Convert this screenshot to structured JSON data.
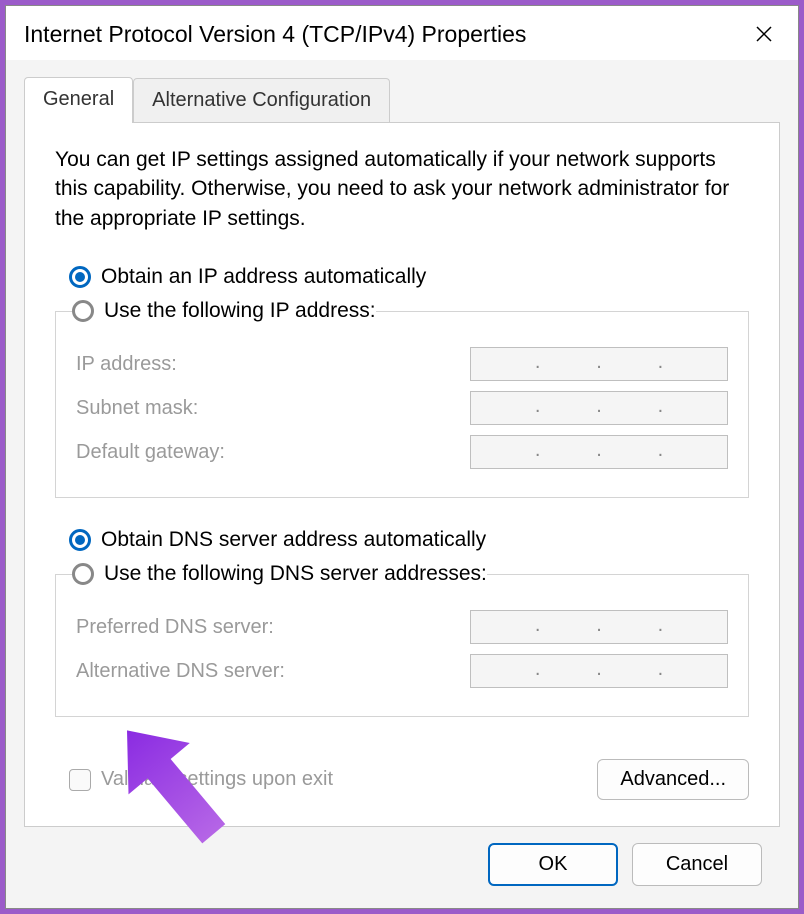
{
  "window": {
    "title": "Internet Protocol Version 4 (TCP/IPv4) Properties"
  },
  "tabs": {
    "general": "General",
    "alternative": "Alternative Configuration"
  },
  "description": "You can get IP settings assigned automatically if your network supports this capability. Otherwise, you need to ask your network administrator for the appropriate IP settings.",
  "ip_section": {
    "auto_label": "Obtain an IP address automatically",
    "manual_label": "Use the following IP address:",
    "selected": "auto",
    "fields": {
      "ip_address": "IP address:",
      "subnet_mask": "Subnet mask:",
      "default_gateway": "Default gateway:"
    }
  },
  "dns_section": {
    "auto_label": "Obtain DNS server address automatically",
    "manual_label": "Use the following DNS server addresses:",
    "selected": "auto",
    "fields": {
      "preferred": "Preferred DNS server:",
      "alternative": "Alternative DNS server:"
    }
  },
  "validate_label": "Validate settings upon exit",
  "buttons": {
    "advanced": "Advanced...",
    "ok": "OK",
    "cancel": "Cancel"
  }
}
